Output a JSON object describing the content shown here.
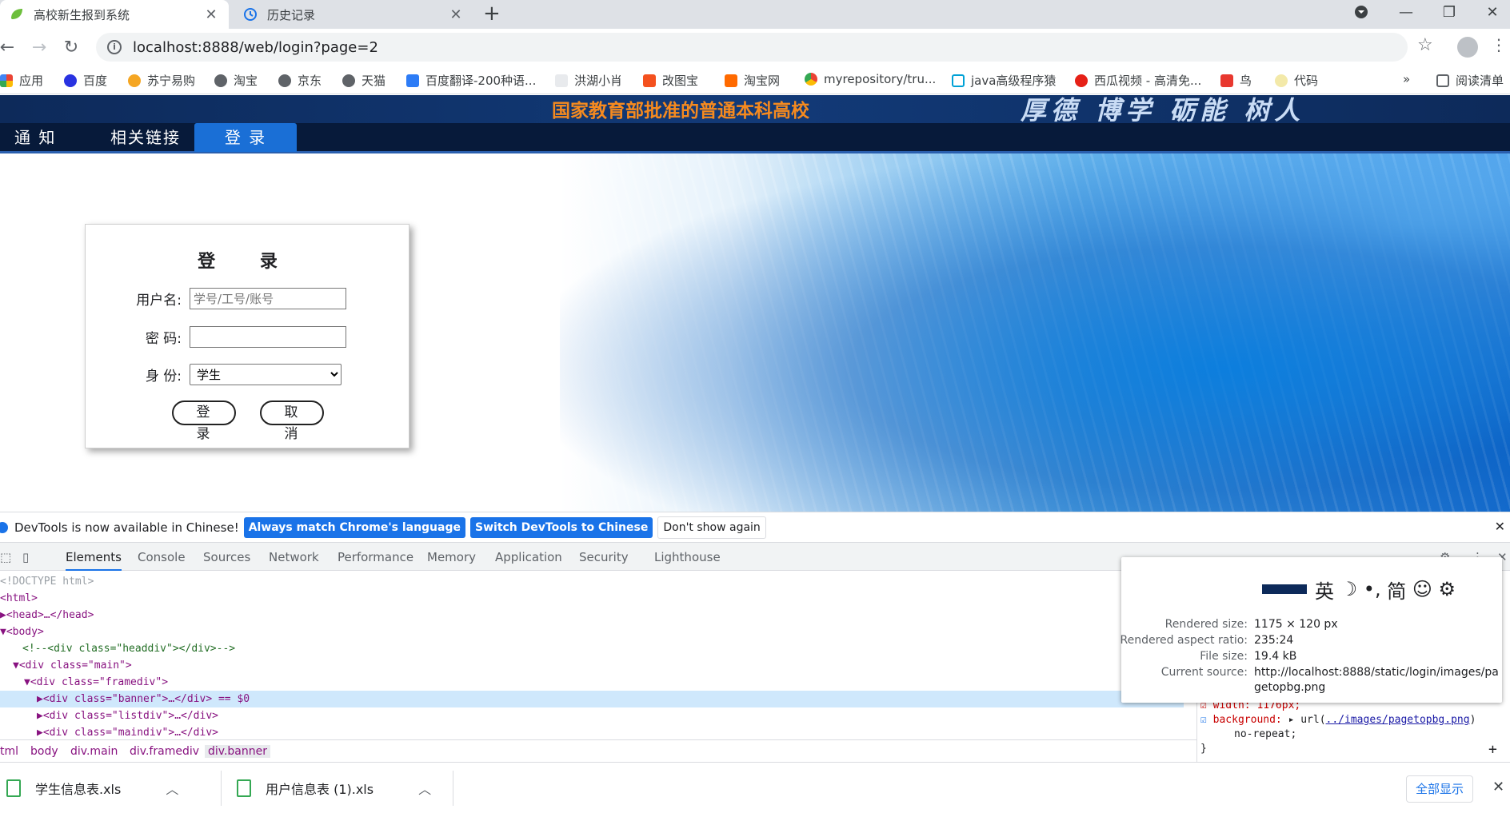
{
  "browser": {
    "tabs": [
      {
        "title": "高校新生报到系统",
        "active": true
      },
      {
        "title": "历史记录",
        "active": false
      }
    ],
    "url": "localhost:8888/web/login?page=2"
  },
  "bookmarks": [
    "应用",
    "百度",
    "苏宁易购",
    "淘宝",
    "京东",
    "天猫",
    "百度翻译-200种语...",
    "洪湖小肖",
    "改图宝",
    "淘宝网",
    "myrepository/tru...",
    "java高级程序猿",
    "西瓜视频 - 高清免...",
    "鸟",
    "代码"
  ],
  "bookmarks_more": "»",
  "reading_list": "阅读清单",
  "page": {
    "banner_motto": "国家教育部批准的普通本科高校",
    "banner_slogan": "厚德 博学 砺能 树人",
    "nav": [
      "通  知",
      "相关链接",
      "登  录"
    ],
    "login": {
      "title": "登 录",
      "username_label": "用户名:",
      "username_placeholder": "学号/工号/账号",
      "password_label": "密  码:",
      "role_label": "身  份:",
      "role_value": "学生",
      "login_button": "登 录",
      "cancel_button": "取 消"
    }
  },
  "devtools": {
    "infobar": {
      "message": "DevTools is now available in Chinese!",
      "btn_match": "Always match Chrome's language",
      "btn_switch": "Switch DevTools to Chinese",
      "btn_dismiss": "Don't show again"
    },
    "tabs": [
      "Elements",
      "Console",
      "Sources",
      "Network",
      "Performance",
      "Memory",
      "Application",
      "Security",
      "Lighthouse"
    ],
    "dom_lines": [
      "<!DOCTYPE html>",
      "<html>",
      "<head>…</head>",
      "<body>",
      "<!--<div class=\"headdiv\"></div>-->",
      "<div class=\"main\">",
      "<div class=\"framediv\">",
      "<div class=\"banner\">…</div> == $0",
      "<div class=\"listdiv\">…</div>",
      "<div class=\"maindiv\">…</div>"
    ],
    "breadcrumbs": [
      "tml",
      "body",
      "div.main",
      "div.framediv",
      "div.banner"
    ],
    "styles": {
      "width_line": "width: 1176px;",
      "background_prop": "background:",
      "background_url": "../images/pagetopbg.png",
      "background_rest": "no-repeat;",
      "close_brace": "}"
    },
    "popup": {
      "rendered_size_label": "Rendered size:",
      "rendered_size": "1175 × 120 px",
      "aspect_label": "Rendered aspect ratio:",
      "aspect": "235:24",
      "file_size_label": "File size:",
      "file_size": "19.4 kB",
      "source_label": "Current source:",
      "source_line1": "http://localhost:8888/static/login/images/pa",
      "source_line2": "getopbg.png",
      "ime": [
        "英",
        "☽",
        "•,",
        "简",
        "☺",
        "⚙"
      ]
    }
  },
  "downloads": {
    "items": [
      "学生信息表.xls",
      "用户信息表 (1).xls"
    ],
    "show_all": "全部显示"
  }
}
